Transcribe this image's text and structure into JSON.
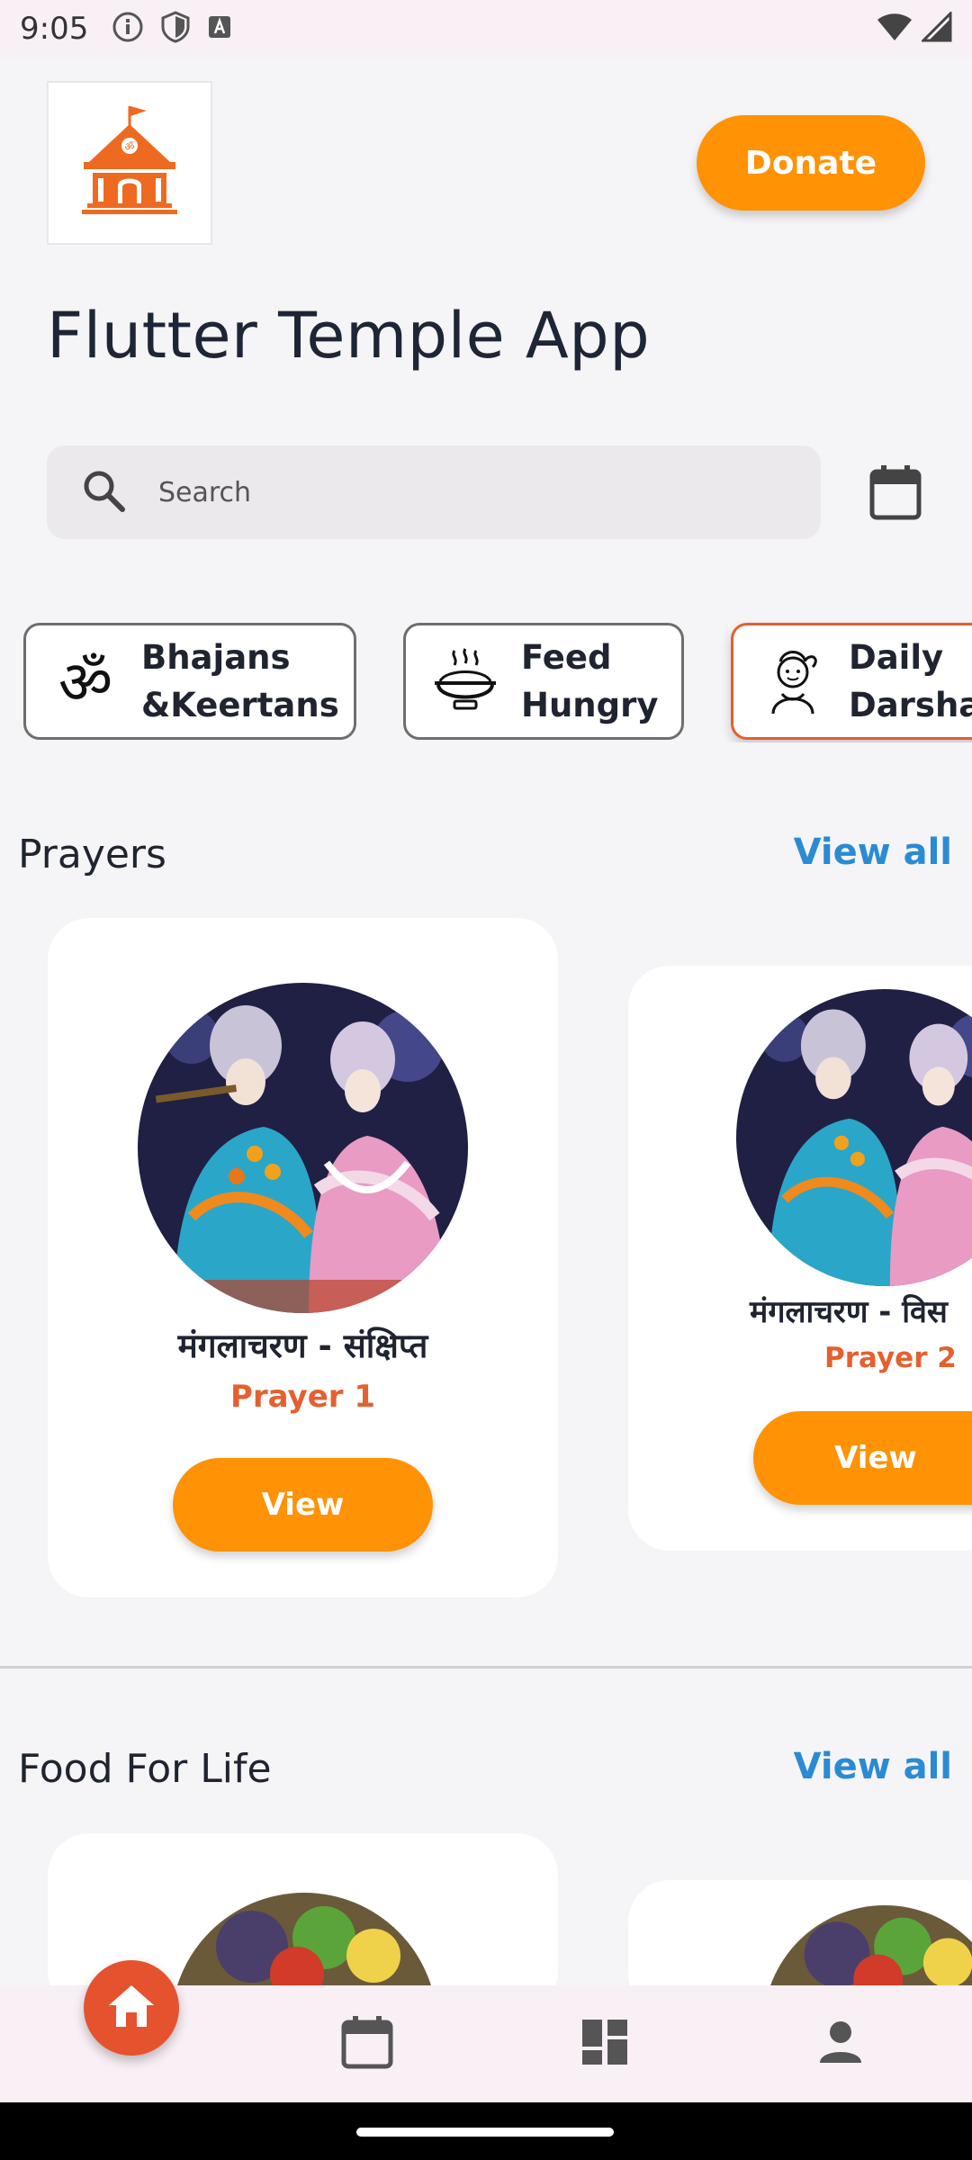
{
  "status_bar": {
    "time": "9:05",
    "left_icons": [
      "info-icon",
      "shield-icon",
      "text-a-icon"
    ],
    "right_icons": [
      "wifi-icon",
      "signal-icon"
    ]
  },
  "header": {
    "logo_icon": "temple-icon",
    "donate_label": "Donate"
  },
  "app_title": "Flutter Temple App",
  "search": {
    "placeholder": "Search",
    "icon": "search-icon",
    "calendar_icon": "calendar-icon"
  },
  "categories": [
    {
      "label": "Bhajans\n&Keertans",
      "icon": "om-icon",
      "selected": false
    },
    {
      "label": "Feed\nHungry",
      "icon": "rice-bowl-icon",
      "selected": false
    },
    {
      "label": "Daily\nDarsha",
      "icon": "deity-icon",
      "selected": true
    }
  ],
  "sections": {
    "prayers": {
      "title": "Prayers",
      "view_all": "View all",
      "cards": [
        {
          "title": "मंगलाचरण - संक्षिप्त",
          "subtitle": "Prayer 1",
          "button": "View"
        },
        {
          "title": "मंगलाचरण - विस",
          "subtitle": "Prayer 2",
          "button": "View"
        }
      ]
    },
    "food": {
      "title": "Food For Life",
      "view_all": "View all"
    }
  },
  "bottom_nav": {
    "items": [
      "home-icon",
      "calendar-icon",
      "dashboard-icon",
      "profile-icon"
    ],
    "active": "home-icon"
  },
  "colors": {
    "accent": "#ff9205",
    "accent_dark": "#e5602f",
    "link": "#2a8bd4"
  }
}
